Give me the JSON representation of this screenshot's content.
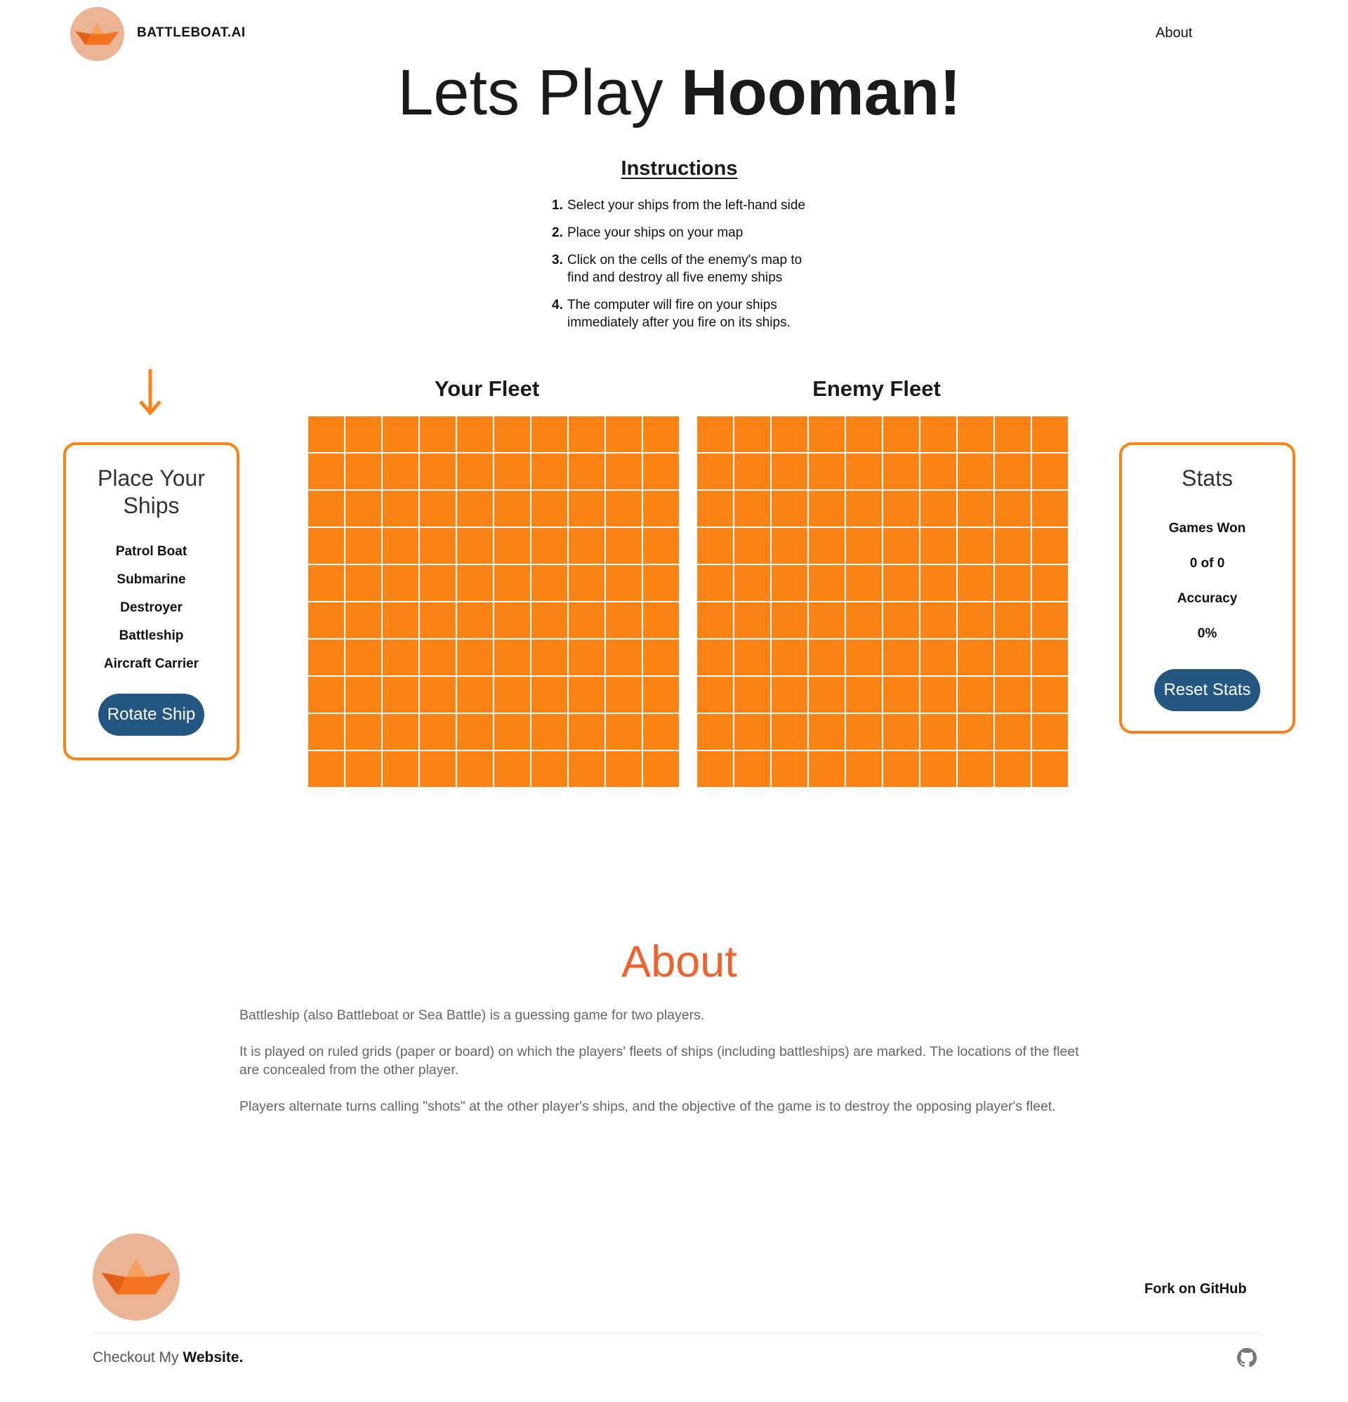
{
  "header": {
    "brand": "BATTLEBOAT.AI",
    "nav_about": "About",
    "logo_icon": "paper-boat-icon"
  },
  "hero": {
    "light": "Lets Play ",
    "bold": "Hooman!"
  },
  "instructions": {
    "title": "Instructions",
    "items": [
      {
        "num": "1.",
        "text": "Select your ships from the left-hand side"
      },
      {
        "num": "2.",
        "text": "Place your ships on your map"
      },
      {
        "num": "3.",
        "text": "Click on the cells of the enemy's map to find and destroy all five enemy ships"
      },
      {
        "num": "4.",
        "text": "The computer will fire on your ships immediately after you fire on its ships."
      }
    ]
  },
  "place_panel": {
    "title": "Place Your Ships",
    "ships": [
      "Patrol Boat",
      "Submarine",
      "Destroyer",
      "Battleship",
      "Aircraft Carrier"
    ],
    "rotate_label": "Rotate Ship"
  },
  "fleets": {
    "your_title": "Your Fleet",
    "enemy_title": "Enemy Fleet",
    "rows": 10,
    "cols": 10,
    "cell_color": "#fb8214"
  },
  "stats_panel": {
    "title": "Stats",
    "games_won_label": "Games Won",
    "games_won_value": "0 of 0",
    "accuracy_label": "Accuracy",
    "accuracy_value": "0%",
    "reset_label": "Reset Stats"
  },
  "about": {
    "title": "About",
    "paragraphs": [
      "Battleship (also Battleboat or Sea Battle) is a guessing game for two players.",
      "It is played on ruled grids (paper or board) on which the players' fleets of ships (including battleships) are marked. The locations of the fleet are concealed from the other player.",
      "Players alternate turns calling \"shots\" at the other player's ships, and the objective of the game is to destroy the opposing player's fleet."
    ]
  },
  "footer": {
    "fork_label": "Fork on GitHub",
    "checkout_prefix": "Checkout My ",
    "checkout_link": "Website.",
    "github_icon": "github-icon"
  },
  "colors": {
    "accent": "#fb8214",
    "button": "#235680",
    "about_title": "#f2602c",
    "logo_bg": "#ebb595"
  }
}
